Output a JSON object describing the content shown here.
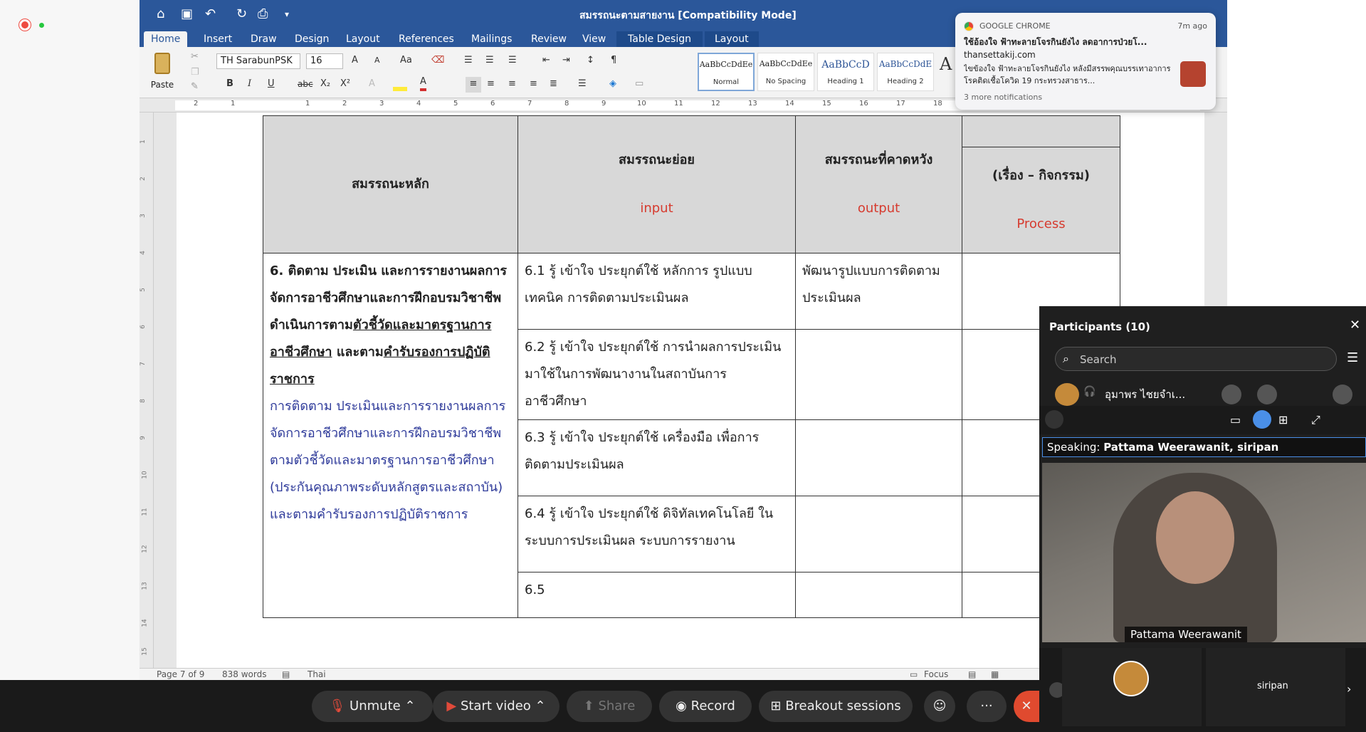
{
  "window": {
    "title": "สมรรถนะตามสายงาน [Compatibility Mode]"
  },
  "ribbon_tabs": [
    "Home",
    "Insert",
    "Draw",
    "Design",
    "Layout",
    "References",
    "Mailings",
    "Review",
    "View",
    "Table Design",
    "Layout"
  ],
  "ribbon": {
    "paste_label": "Paste",
    "font_name": "TH SarabunPSK",
    "font_size": "16",
    "bold": "B",
    "italic": "I",
    "underline": "U",
    "strike": "abc",
    "subscript": "X₂",
    "superscript": "X²",
    "pilcrow": "¶",
    "font_color_letter": "A",
    "aa_label": "Aa",
    "big_a": "A",
    "tick": "A",
    "ghost": "A",
    "styles": [
      {
        "preview": "AaBbCcDdEe",
        "name": "Normal"
      },
      {
        "preview": "AaBbCcDdEe",
        "name": "No Spacing"
      },
      {
        "preview": "AaBbCcD",
        "name": "Heading 1"
      },
      {
        "preview": "AaBbCcDdE",
        "name": "Heading 2"
      }
    ],
    "style_more": "A"
  },
  "ruler_numbers": [
    "2",
    "1",
    "",
    "1",
    "2",
    "3",
    "4",
    "5",
    "6",
    "7",
    "8",
    "9",
    "10",
    "11",
    "12",
    "13",
    "14",
    "15",
    "16",
    "17",
    "18"
  ],
  "vruler_numbers": [
    "1",
    "2",
    "3",
    "4",
    "5",
    "6",
    "7",
    "8",
    "9",
    "10",
    "11",
    "12",
    "13",
    "14",
    "15"
  ],
  "table": {
    "headers": {
      "main": "สมรรถนะหลัก",
      "sub": "สมรรถนะย่อย",
      "sub_en": "input",
      "expected": "สมรรถนะที่คาดหวัง",
      "expected_en": "output",
      "process_top": "",
      "process": "(เรื่อง – กิจกรรม)",
      "process_en": "Process"
    },
    "main_bold_1": "6. ติดตาม ประเมิน และการรายงานผลการจัดการอาชีวศึกษาและการฝึกอบรมวิชาชีพ ดำเนินการตาม",
    "main_ul_1": "ตัวชี้วัดและมาตรฐานการอาชีวศึกษา",
    "main_bold_2": " และตาม",
    "main_ul_2": "คำรับรองการปฏิบัติราชการ",
    "main_blue": "การติดตาม ประเมินและการรายงานผลการจัดการอาชีวศึกษาและการฝึกอบรมวิชาชีพ ตามตัวชี้วัดและมาตรฐานการอาชีวศึกษา (ประกันคุณภาพระดับหลักสูตรและสถาบัน) และตามคำรับรองการปฏิบัติราชการ",
    "rows": [
      {
        "sub": "6.1 รู้ เข้าใจ ประยุกต์ใช้ หลักการ รูปแบบ เทคนิค การติดตามประเมินผล",
        "expected": "พัฒนารูปแบบการติดตามประเมินผล"
      },
      {
        "sub": "6.2 รู้ เข้าใจ ประยุกต์ใช้ การนำผลการประเมินมาใช้ในการพัฒนางานในสถาบันการอาชีวศึกษา",
        "expected": ""
      },
      {
        "sub": "6.3 รู้ เข้าใจ ประยุกต์ใช้ เครื่องมือ เพื่อการติดตามประเมินผล",
        "expected": ""
      },
      {
        "sub": "6.4 รู้ เข้าใจ ประยุกต์ใช้ ดิจิทัลเทคโนโลยี ในระบบการประเมินผล ระบบการรายงาน",
        "expected": ""
      },
      {
        "sub": "6.5",
        "expected": ""
      }
    ]
  },
  "status": {
    "page": "Page 7 of 9",
    "words": "838 words",
    "language": "Thai",
    "focus": "Focus"
  },
  "notification": {
    "app": "GOOGLE CHROME",
    "time": "7m ago",
    "title": "ใช้อ้องใจ ฟ้าทะลายโจรกินยังไง ลดอาการป่วยโ...",
    "site": "thansettakij.com",
    "body": "ไขข้องใจ ฟ้าทะลายโจรกินยังไง หลังมีสรรพคุณบรรเทาอาการโรคติดเชื้อโควิด 19 กระทรวงสาธาร...",
    "more": "3 more notifications"
  },
  "participants": {
    "title": "Participants (10)",
    "search_placeholder": "Search",
    "first_name": "อุมาพร ไชยจำเ...",
    "speaking_label": "Speaking:",
    "speaking_names": "Pattama Weerawanit, siripan",
    "video_name": "Pattama Weerawanit",
    "thumb_name": "siripan"
  },
  "zoom_toolbar": {
    "unmute": "Unmute",
    "start_video": "Start video",
    "share": "Share",
    "record": "Record",
    "breakout": "Breakout sessions",
    "more": "···"
  },
  "colors": {
    "word_blue": "#2b579a",
    "zoom_dark": "#1a1a1a",
    "header_gray": "#d8d8d8",
    "accent_red": "#d63b2f",
    "blue_text": "#2e3a9a"
  }
}
